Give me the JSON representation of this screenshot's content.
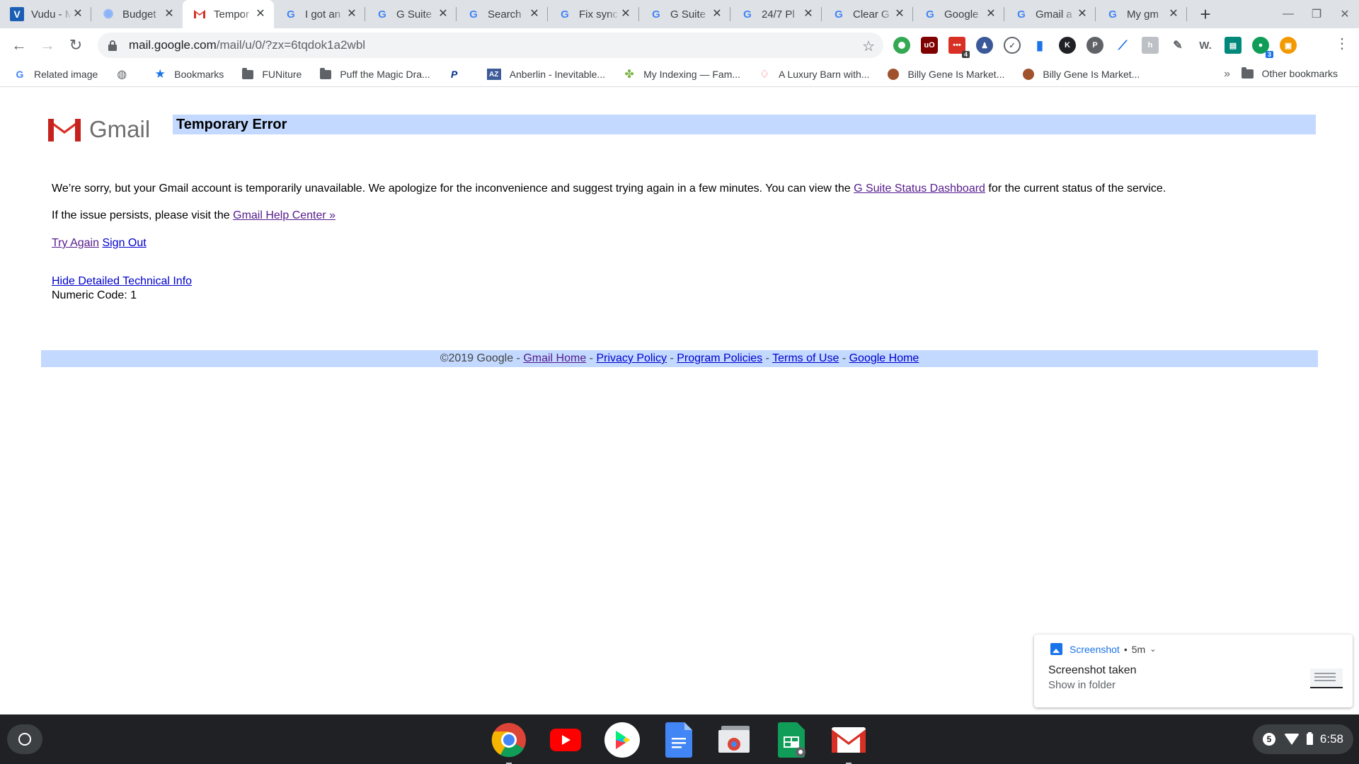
{
  "tabs": [
    {
      "title": "Vudu - M",
      "icon": "vudu-icon",
      "active": false
    },
    {
      "title": "Budget",
      "icon": "budget-icon",
      "active": false
    },
    {
      "title": "Tempor",
      "icon": "gmail-icon",
      "active": true
    },
    {
      "title": "I got an",
      "icon": "google-icon",
      "active": false
    },
    {
      "title": "G Suite",
      "icon": "google-icon",
      "active": false
    },
    {
      "title": "Search",
      "icon": "google-icon",
      "active": false
    },
    {
      "title": "Fix sync",
      "icon": "google-icon",
      "active": false
    },
    {
      "title": "G Suite",
      "icon": "google-icon",
      "active": false
    },
    {
      "title": "24/7 Pl",
      "icon": "google-icon",
      "active": false
    },
    {
      "title": "Clear G",
      "icon": "google-icon",
      "active": false
    },
    {
      "title": "Google",
      "icon": "google-icon",
      "active": false
    },
    {
      "title": "Gmail a",
      "icon": "google-icon",
      "active": false
    },
    {
      "title": "My gm",
      "icon": "google-icon",
      "active": false
    }
  ],
  "toolbar": {
    "url_host": "mail.google.com",
    "url_path": "/mail/u/0/?zx=6tqdok1a2wbl",
    "extension_badges": {
      "ublock": "4",
      "chat": "3"
    }
  },
  "bookmarks": [
    {
      "label": "Related image",
      "icon": "google-icon"
    },
    {
      "label": "",
      "icon": "globe-icon"
    },
    {
      "label": "Bookmarks",
      "icon": "star-icon"
    },
    {
      "label": "FUNiture",
      "icon": "folder-icon"
    },
    {
      "label": "Puff the Magic Dra...",
      "icon": "folder-icon"
    },
    {
      "label": "",
      "icon": "paypal-icon"
    },
    {
      "label": "Anberlin - Inevitable...",
      "icon": "az-icon"
    },
    {
      "label": "My Indexing — Fam...",
      "icon": "clover-icon"
    },
    {
      "label": "A Luxury Barn with...",
      "icon": "airbnb-icon"
    },
    {
      "label": "Billy Gene Is Market...",
      "icon": "person-icon"
    },
    {
      "label": "Billy Gene Is Market...",
      "icon": "person-icon"
    }
  ],
  "bookmarks_more": "»",
  "other_bookmarks": "Other bookmarks",
  "page": {
    "logo_text": "Gmail",
    "error_title": "Temporary Error",
    "msg1_pre": "We’re sorry, but your Gmail account is temporarily unavailable. We apologize for the inconvenience and suggest trying again in a few minutes. You can view the ",
    "msg1_link": "G Suite Status Dashboard",
    "msg1_post": " for the current status of the service.",
    "msg2_pre": "If the issue persists, please visit the ",
    "msg2_link": "Gmail Help Center »",
    "try_again": "Try Again",
    "sign_out": "Sign Out",
    "hide_info": "Hide Detailed Technical Info",
    "numeric_code": "Numeric Code: 1"
  },
  "footer": {
    "copyright": "©2019 Google - ",
    "links": [
      "Gmail Home",
      "Privacy Policy",
      "Program Policies",
      "Terms of Use",
      "Google Home"
    ],
    "sep": " - "
  },
  "notification": {
    "app": "Screenshot",
    "time": "5m",
    "title": "Screenshot taken",
    "subtitle": "Show in folder"
  },
  "shelf": {
    "apps": [
      "chrome-icon",
      "youtube-icon",
      "play-store-icon",
      "docs-icon",
      "screen-capture-icon",
      "sheets-icon",
      "gmail-icon"
    ],
    "notification_count": "5",
    "time": "6:58"
  },
  "colors": {
    "error_bar": "#c3d9ff",
    "link": "#0000cc",
    "link_visited": "#551a8b",
    "gmail_red": "#d93025"
  }
}
